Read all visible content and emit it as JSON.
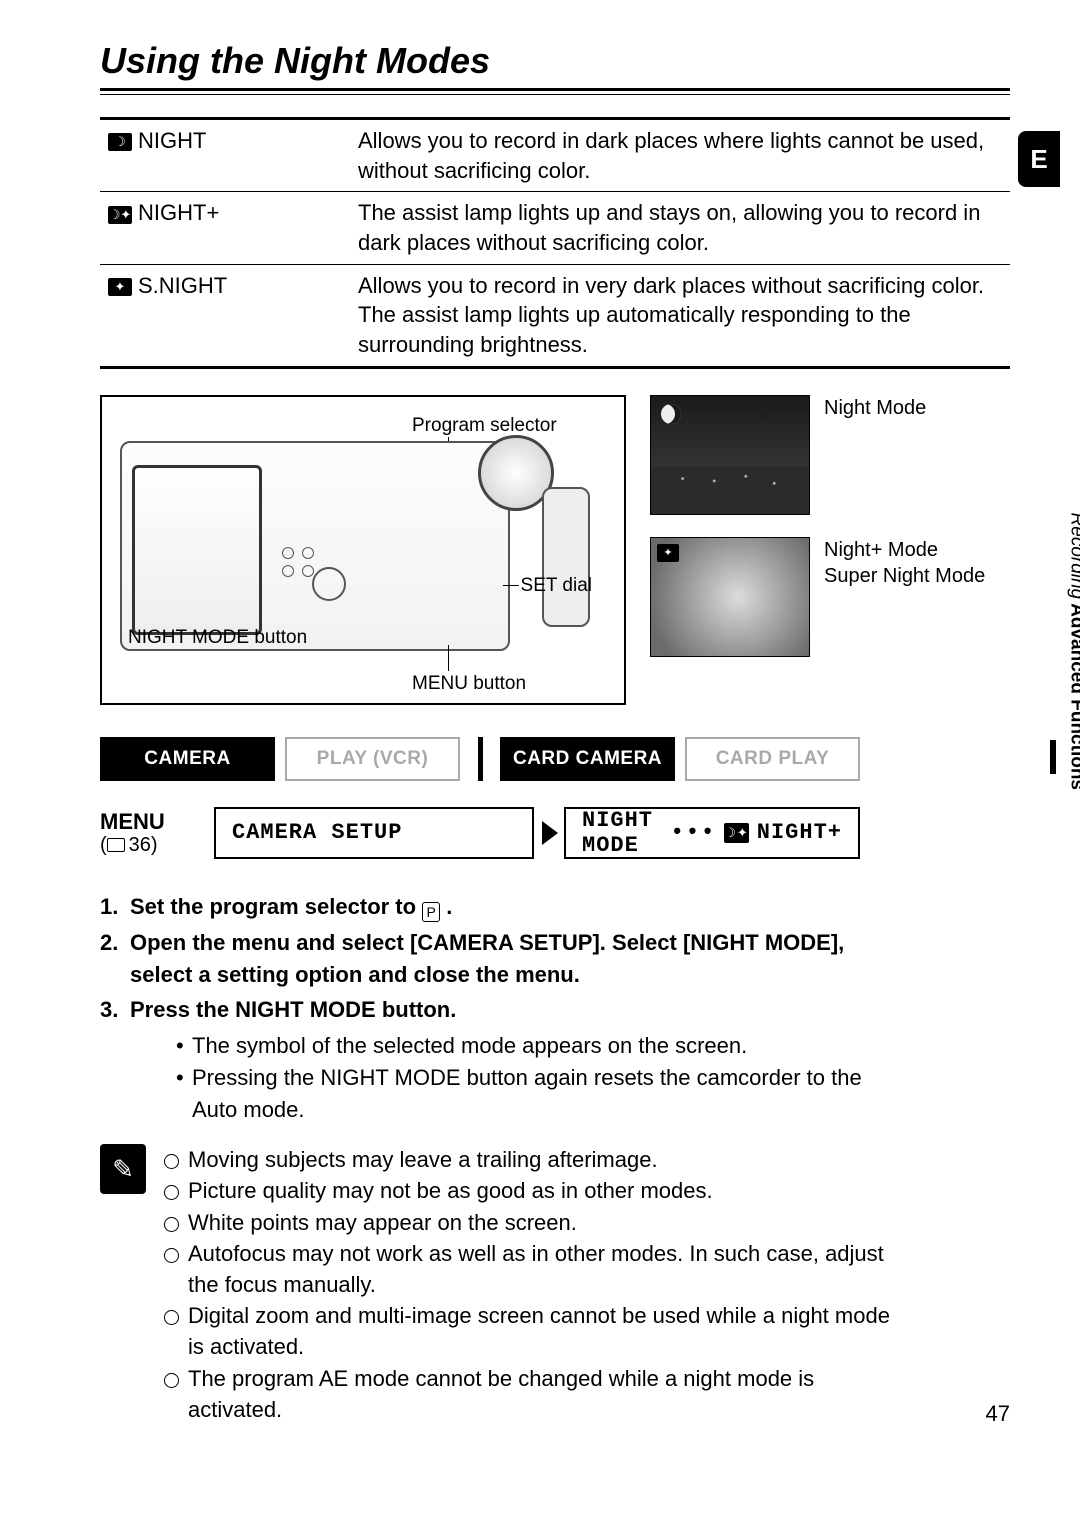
{
  "title": "Using the Night Modes",
  "lang_tab": "E",
  "page_number": "47",
  "side_label": {
    "section": "Advanced Functions",
    "sub": "Recording"
  },
  "modes_table": [
    {
      "icon": "☽",
      "name": "NIGHT",
      "desc": "Allows you to record in dark places where lights cannot be used, without sacrificing color."
    },
    {
      "icon": "☽✦",
      "name": "NIGHT+",
      "desc": "The assist lamp lights up and stays on, allowing you to record in dark places without sacrificing color."
    },
    {
      "icon": "✦",
      "name": "S.NIGHT",
      "desc": "Allows you to record in very dark places without sacrificing color. The assist lamp lights up automatically responding to the surrounding brightness."
    }
  ],
  "diagram_labels": {
    "program_selector": "Program selector",
    "set_dial": "SET dial",
    "night_mode_button": "NIGHT MODE button",
    "menu_button": "MENU button"
  },
  "sample_captions": {
    "night": "Night Mode",
    "night_plus": "Night+ Mode",
    "super_night": "Super Night Mode"
  },
  "mode_pills": {
    "camera": "CAMERA",
    "play_vcr": "PLAY (VCR)",
    "card_camera": "CARD CAMERA",
    "card_play": "CARD PLAY"
  },
  "menu_path": {
    "label": "MENU",
    "page_ref": "36",
    "left_box": "CAMERA SETUP",
    "right_prefix": "NIGHT MODE",
    "right_value": "NIGHT+"
  },
  "steps": [
    {
      "title_before": "Set the program selector to ",
      "title_p_icon": "P",
      "title_after": "."
    },
    {
      "title": "Open the menu and select [CAMERA SETUP]. Select [NIGHT MODE], select a setting option and close the menu."
    },
    {
      "title": "Press the NIGHT MODE button.",
      "sub": [
        "The symbol of the selected mode appears on the screen.",
        "Pressing the NIGHT MODE button again resets the camcorder to the Auto mode."
      ]
    }
  ],
  "notes": [
    "Moving subjects may leave a trailing afterimage.",
    "Picture quality may not be as good as in other modes.",
    "White points may appear on the screen.",
    "Autofocus may not work as well as in other modes. In such case, adjust the focus manually.",
    "Digital zoom and multi-image screen cannot be used while a night mode is activated.",
    "The program AE mode cannot be changed while a night mode is activated."
  ]
}
